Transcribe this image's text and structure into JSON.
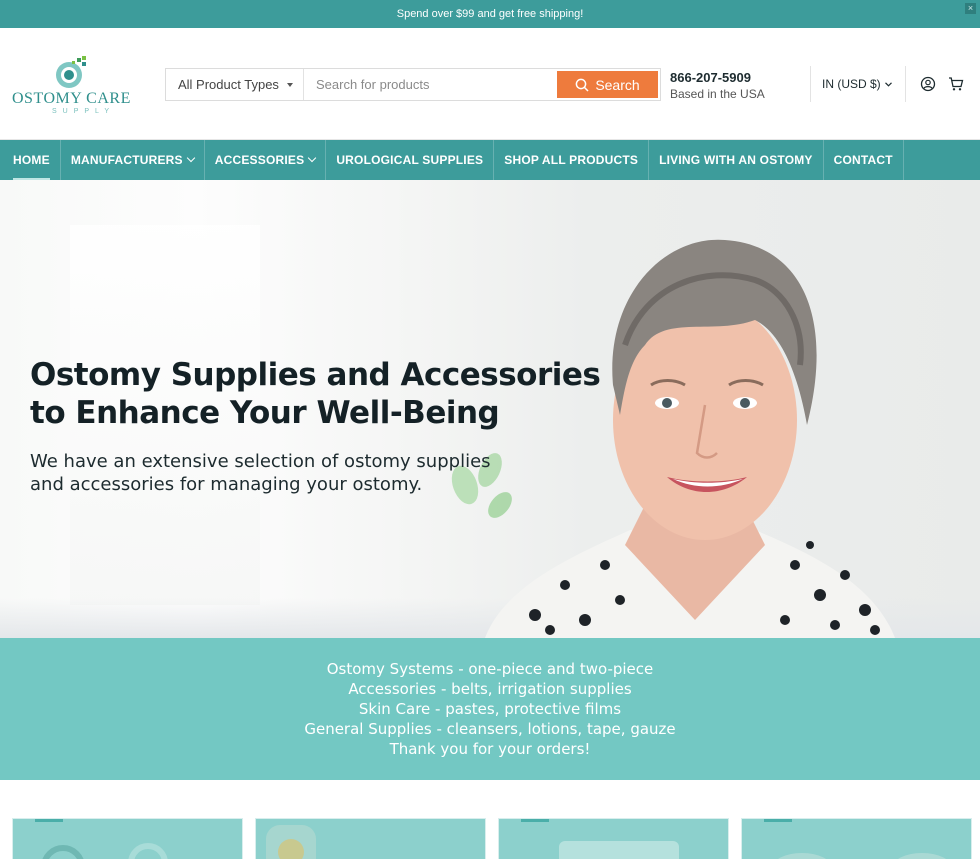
{
  "announcement": {
    "text": "Spend over $99 and get free shipping!"
  },
  "logo": {
    "name": "OSTOMY CARE",
    "tagline": "SUPPLY"
  },
  "search": {
    "product_type_label": "All Product Types",
    "placeholder": "Search for products",
    "button_label": "Search"
  },
  "contact": {
    "phone": "866-207-5909",
    "note": "Based in the USA"
  },
  "currency": {
    "label": "IN (USD $)"
  },
  "nav": {
    "items": [
      {
        "label": "HOME",
        "dropdown": false,
        "active": true
      },
      {
        "label": "MANUFACTURERS",
        "dropdown": true
      },
      {
        "label": "ACCESSORIES",
        "dropdown": true
      },
      {
        "label": "UROLOGICAL SUPPLIES",
        "dropdown": false
      },
      {
        "label": "SHOP ALL PRODUCTS",
        "dropdown": false
      },
      {
        "label": "LIVING WITH AN OSTOMY",
        "dropdown": false
      },
      {
        "label": "CONTACT",
        "dropdown": false
      }
    ]
  },
  "hero": {
    "title_line1": "Ostomy Supplies and Accessories",
    "title_line2": "to Enhance Your Well-Being",
    "subtitle": "We have an extensive selection of ostomy supplies and accessories for managing your ostomy."
  },
  "band": {
    "lines": [
      "Ostomy Systems - one-piece and two-piece",
      "Accessories - belts, irrigation supplies",
      "Skin Care - pastes, protective films",
      "General Supplies - cleansers, lotions, tape, gauze",
      "Thank you for your orders!"
    ]
  },
  "colors": {
    "brand_teal": "#3d9c9b",
    "band_teal": "#73c8c3",
    "search_orange": "#ee7b3d"
  }
}
